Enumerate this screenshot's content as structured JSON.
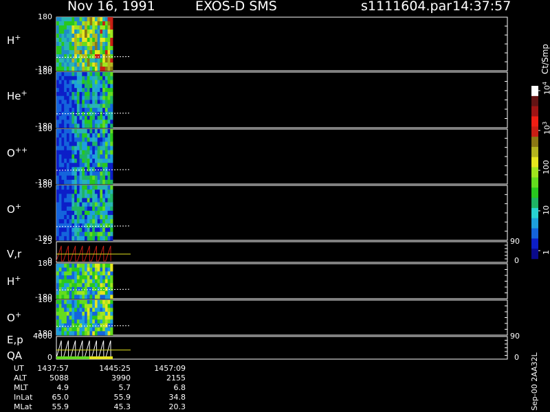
{
  "header": {
    "date": "Nov 16, 1991",
    "instrument": "EXOS-D SMS",
    "file": "s1111604.par",
    "time": "14:37:57"
  },
  "chart_data": {
    "type": "heatmap",
    "panels": [
      {
        "label_base": "H",
        "label_sup": "+",
        "ymax": "180",
        "ymin": "-180",
        "kind": "spectrogram",
        "variant": "a"
      },
      {
        "label_base": "He",
        "label_sup": "+",
        "ymax": "180",
        "ymin": "-180",
        "kind": "spectrogram",
        "variant": "b"
      },
      {
        "label_base": "O",
        "label_sup": "++",
        "ymax": "180",
        "ymin": "-180",
        "kind": "spectrogram",
        "variant": "b"
      },
      {
        "label_base": "O",
        "label_sup": "+",
        "ymax": "180",
        "ymin": "-180",
        "kind": "spectrogram",
        "variant": "b"
      },
      {
        "label_base": "V,r",
        "label_sup": "",
        "ymax": "25",
        "ymin": "0",
        "kind": "line",
        "right_top": "90",
        "right_bottom": "0"
      },
      {
        "label_base": "H",
        "label_sup": "+",
        "ymax": "180",
        "ymin": "-180",
        "kind": "spectrogram",
        "variant": "c"
      },
      {
        "label_base": "O",
        "label_sup": "+",
        "ymax": "180",
        "ymin": "-180",
        "kind": "spectrogram",
        "variant": "c"
      },
      {
        "label_base": "E,p",
        "label_sup": "",
        "label2": "QA",
        "ymax": "4000",
        "ymin": "0",
        "kind": "line",
        "right_top": "90",
        "right_bottom": "0"
      }
    ],
    "colorbar": {
      "title": "Ct/Smp",
      "tick_labels": [
        "1",
        "10",
        "100",
        "10",
        "10"
      ],
      "tick_sups": [
        "",
        "",
        "",
        "3",
        "4"
      ],
      "colors": [
        "#0a0a8c",
        "#0c1ec8",
        "#1464dc",
        "#1ea0dc",
        "#28d2d2",
        "#1eb464",
        "#28c81e",
        "#64dc1e",
        "#a0e61e",
        "#e6e61e",
        "#b4b41e",
        "#8c7814",
        "#c81e14",
        "#f01e14",
        "#a01414",
        "#641414",
        "#ffffff"
      ],
      "log_scale": true,
      "vmin": 1,
      "vmax": 10000
    },
    "time_labels": [
      "1437:57",
      "1445:25",
      "1457:09"
    ]
  },
  "orbit": {
    "rows": [
      {
        "label": "UT",
        "values": [
          "1437:57",
          "1445:25",
          "1457:09"
        ]
      },
      {
        "label": "ALT",
        "values": [
          "5088",
          "3990",
          "2155"
        ]
      },
      {
        "label": "MLT",
        "values": [
          "4.9",
          "5.7",
          "6.8"
        ]
      },
      {
        "label": "InLat",
        "values": [
          "65.0",
          "55.9",
          "34.8"
        ]
      },
      {
        "label": "MLat",
        "values": [
          "55.9",
          "45.3",
          "20.3"
        ]
      }
    ]
  },
  "footer_id": "Sep-00 2AA32L"
}
